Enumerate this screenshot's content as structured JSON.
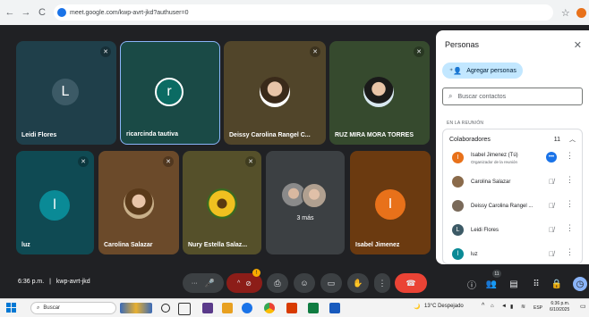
{
  "browser": {
    "url": "meet.google.com/kwp-avrt-jkd?authuser=0",
    "back_icon": "←",
    "forward_icon": "→",
    "reload_icon": "C",
    "star_icon": "☆"
  },
  "tiles": [
    {
      "name": "Leidi Flores",
      "initial": "L",
      "bg": "#1f3f4a",
      "avatar_bg": "#3c5a66"
    },
    {
      "name": "ricarcinda tautiva",
      "initial": "r",
      "bg": "#1a4a46",
      "avatar_bg": "#0b6b63"
    },
    {
      "name": "Deissy Carolina Rangel C...",
      "bg": "#51452a"
    },
    {
      "name": "RUZ MIRA MORA TORRES",
      "bg": "#364a2e"
    },
    {
      "name": "luz",
      "initial": "l",
      "bg": "#0f4a53",
      "avatar_bg": "#0a8a96"
    },
    {
      "name": "Carolina Salazar",
      "bg": "#6b4a2a"
    },
    {
      "name": "Nury Estella Salaz...",
      "bg": "#55502a"
    },
    {
      "label": "3 más",
      "bg": "#3c4043"
    },
    {
      "name": "Isabel Jimenez",
      "initial": "I",
      "bg": "#6b3a10",
      "avatar_bg": "#e8711a"
    }
  ],
  "panel": {
    "title": "Personas",
    "add_label": "Agregar personas",
    "search_placeholder": "Buscar contactos",
    "section": "EN LA REUNIÓN",
    "group_label": "Colaboradores",
    "group_count": "11",
    "people": [
      {
        "name": "Isabel Jimenez (Tú)",
        "role": "Organizador de la reunión",
        "initial": "I",
        "color": "#e8711a"
      },
      {
        "name": "Carolina Salazar",
        "initial": "",
        "color": "#8a6a4a"
      },
      {
        "name": "Deissy Carolina Rangel ...",
        "initial": "",
        "color": "#7a6a5a"
      },
      {
        "name": "Leidi Flores",
        "initial": "L",
        "color": "#3c5a66"
      },
      {
        "name": "luz",
        "initial": "l",
        "color": "#0a8a96"
      }
    ]
  },
  "controls": {
    "time": "6:36 p.m.",
    "separator": "|",
    "meeting_code": "kwp-avrt-jkd",
    "participants_count": "11",
    "warning_badge": "!"
  },
  "taskbar": {
    "search_label": "Buscar",
    "weather": "13°C Despejado",
    "lang": "ESP",
    "time": "6:36 p.m.",
    "date": "6/10/2025"
  }
}
